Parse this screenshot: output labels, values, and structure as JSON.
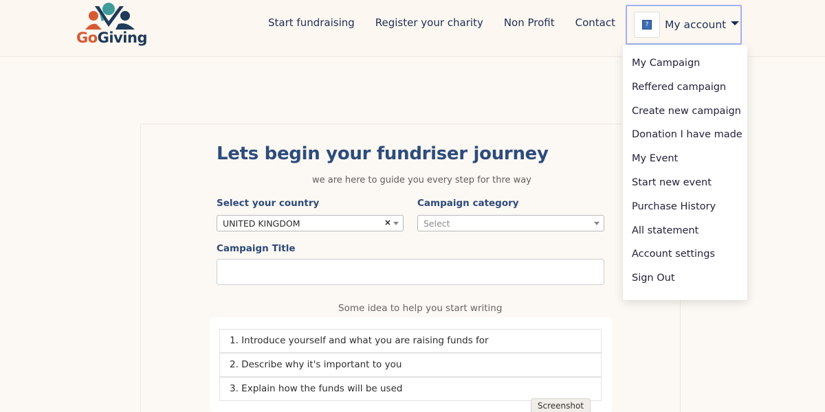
{
  "header": {
    "logo": {
      "text_prefix": "Go",
      "text_accent": "G",
      "text_suffix": "iving"
    },
    "nav": [
      {
        "label": "Start fundraising"
      },
      {
        "label": "Register your charity"
      },
      {
        "label": "Non Profit"
      },
      {
        "label": "Contact"
      }
    ],
    "account": {
      "label": "My account",
      "avatar_glyph": "?"
    }
  },
  "dropdown": {
    "items": [
      {
        "label": "My Campaign"
      },
      {
        "label": "Reffered campaign"
      },
      {
        "label": "Create new campaign"
      },
      {
        "label": "Donation I have made"
      },
      {
        "label": "My Event"
      },
      {
        "label": "Start new event"
      },
      {
        "label": "Purchase History"
      },
      {
        "label": "All statement"
      },
      {
        "label": "Account settings"
      },
      {
        "label": "Sign Out"
      }
    ]
  },
  "form": {
    "title": "Lets begin your fundriser journey",
    "subtitle": "we are here to guide you every step for thre way",
    "country": {
      "label": "Select your country",
      "value": "UNITED KINGDOM",
      "clear_glyph": "×"
    },
    "category": {
      "label": "Campaign category",
      "placeholder": "Select"
    },
    "campaign_title": {
      "label": "Campaign Title",
      "value": ""
    },
    "ideas_header": "Some idea to help you start writing",
    "ideas": [
      "1. Introduce yourself and what you are raising funds for",
      "2. Describe why it's important to you",
      "3. Explain how the funds will be used"
    ]
  },
  "overlay": {
    "screenshot_label": "Screenshot"
  },
  "colors": {
    "background": "#fcf8f3",
    "nav_text": "#1d2f55",
    "title": "#2d4c7c",
    "brand_orange": "#d75a35",
    "brand_teal": "#3f9b99",
    "brand_navy": "#1f3a5a",
    "account_border": "#9fb2f0"
  }
}
